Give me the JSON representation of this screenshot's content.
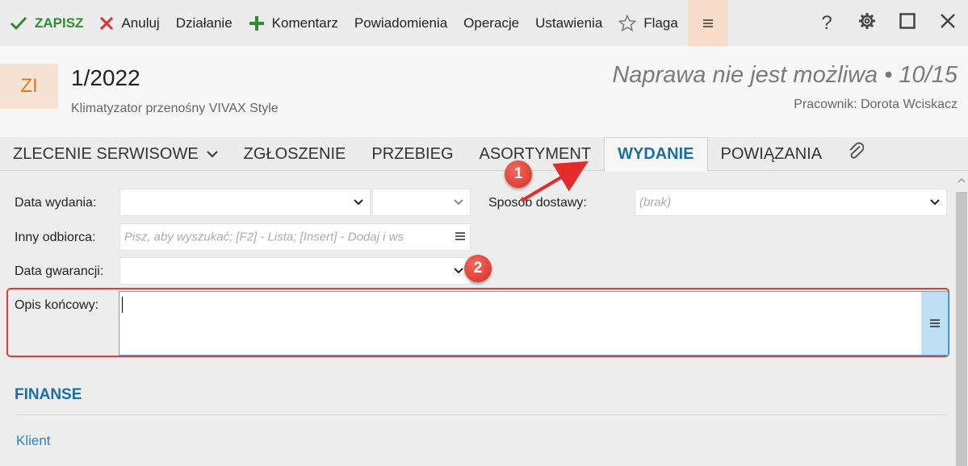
{
  "toolbar": {
    "save": "ZAPISZ",
    "cancel": "Anuluj",
    "action": "Działanie",
    "comment": "Komentarz",
    "notifications": "Powiadomienia",
    "operations": "Operacje",
    "settings": "Ustawienia",
    "flag": "Flaga"
  },
  "header": {
    "badge": "ZI",
    "number": "1/2022",
    "subtitle": "Klimatyzator przenośny VIVAX Style",
    "status": "Naprawa nie jest możliwa • 10/15",
    "worker": "Pracownik: Dorota Wciskacz"
  },
  "tabs": [
    {
      "label": "ZLECENIE SERWISOWE"
    },
    {
      "label": "ZGŁOSZENIE"
    },
    {
      "label": "PRZEBIEG"
    },
    {
      "label": "ASORTYMENT"
    },
    {
      "label": "WYDANIE",
      "active": true
    },
    {
      "label": "POWIĄZANIA"
    }
  ],
  "form": {
    "data_wydania_label": "Data wydania:",
    "sposob_dostawy_label": "Sposób dostawy:",
    "sposob_dostawy_placeholder": "(brak)",
    "inny_odbiorca_label": "Inny odbiorca:",
    "inny_odbiorca_placeholder": "Pisz, aby wyszukać; [F2] - Lista; [Insert] - Dodaj i ws",
    "data_gwarancji_label": "Data gwarancji:",
    "opis_koncowy_label": "Opis końcowy:",
    "opis_koncowy_value": ""
  },
  "finance": {
    "title": "FINANSE",
    "client_link": "Klient"
  },
  "annotations": {
    "marker1": "1",
    "marker2": "2"
  },
  "colors": {
    "accent": "#1a6ea8",
    "save": "#2e8b2e",
    "cancel": "#d93030",
    "badge_bg": "#f6e3d4",
    "badge_fg": "#e07626",
    "highlight": "#e23b3b"
  }
}
